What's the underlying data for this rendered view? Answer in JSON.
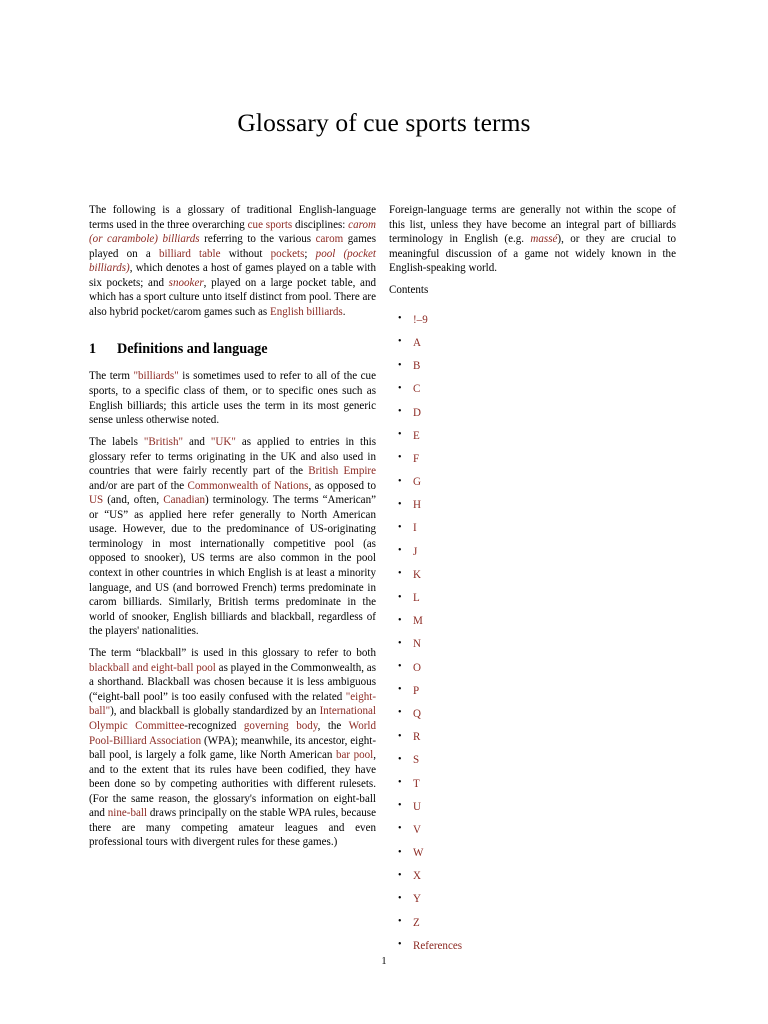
{
  "document": {
    "title": "Glossary of cue sports terms",
    "page_number": "1",
    "link_color": "#8c2a23",
    "text_color": "#000000",
    "background_color": "#ffffff"
  },
  "left_column": {
    "intro": {
      "runs": [
        {
          "text": "The following is a glossary of traditional English-language terms used in the three overarching ",
          "style": "plain"
        },
        {
          "text": "cue sports",
          "style": "link"
        },
        {
          "text": " disciplines: ",
          "style": "plain"
        },
        {
          "text": "carom (or carambole) billiards",
          "style": "link-italic"
        },
        {
          "text": " referring to the various ",
          "style": "plain"
        },
        {
          "text": "carom",
          "style": "link"
        },
        {
          "text": " games played on a ",
          "style": "plain"
        },
        {
          "text": "billiard table",
          "style": "link"
        },
        {
          "text": " without ",
          "style": "plain"
        },
        {
          "text": "pockets",
          "style": "link"
        },
        {
          "text": "; ",
          "style": "plain"
        },
        {
          "text": "pool (pocket billiards)",
          "style": "link-italic"
        },
        {
          "text": ", which denotes a host of games played on a table with six pockets; and ",
          "style": "plain"
        },
        {
          "text": "snooker",
          "style": "link-italic"
        },
        {
          "text": ", played on a large pocket table, and which has a sport culture unto itself distinct from pool. There are also hybrid pocket/carom games such as ",
          "style": "plain"
        },
        {
          "text": "English billiards",
          "style": "link"
        },
        {
          "text": ".",
          "style": "plain"
        }
      ]
    },
    "section": {
      "number": "1",
      "title": "Definitions and language"
    },
    "para_billiards": {
      "runs": [
        {
          "text": "The term ",
          "style": "plain"
        },
        {
          "text": "\"billiards\"",
          "style": "link"
        },
        {
          "text": " is sometimes used to refer to all of the cue sports, to a specific class of them, or to specific ones such as English billiards; this article uses the term in its most generic sense unless otherwise noted.",
          "style": "plain"
        }
      ]
    },
    "para_labels": {
      "runs": [
        {
          "text": "The labels ",
          "style": "plain"
        },
        {
          "text": "\"British\"",
          "style": "link"
        },
        {
          "text": " and ",
          "style": "plain"
        },
        {
          "text": "\"UK\"",
          "style": "link"
        },
        {
          "text": " as applied to entries in this glossary refer to terms originating in the UK and also used in countries that were fairly recently part of the ",
          "style": "plain"
        },
        {
          "text": "British Empire",
          "style": "link"
        },
        {
          "text": " and/or are part of the ",
          "style": "plain"
        },
        {
          "text": "Commonwealth of Nations",
          "style": "link"
        },
        {
          "text": ", as opposed to ",
          "style": "plain"
        },
        {
          "text": "US",
          "style": "link"
        },
        {
          "text": " (and, often, ",
          "style": "plain"
        },
        {
          "text": "Canadian",
          "style": "link"
        },
        {
          "text": ") terminology. The terms “American” or “US” as applied here refer generally to North American usage. However, due to the predominance of US-originating terminology in most internationally competitive pool (as opposed to snooker), US terms are also common in the pool context in other countries in which English is at least a minority language, and US (and borrowed French) terms predominate in carom billiards. Similarly, British terms predominate in the world of snooker, English billiards and blackball, regardless of the players' nationalities.",
          "style": "plain"
        }
      ]
    },
    "para_blackball": {
      "runs": [
        {
          "text": "The term “blackball” is used in this glossary to refer to both ",
          "style": "plain"
        },
        {
          "text": "blackball and eight-ball pool",
          "style": "link"
        },
        {
          "text": " as played in the Commonwealth, as a shorthand. Blackball was chosen because it is less ambiguous (“eight-ball pool” is too easily confused with the related ",
          "style": "plain"
        },
        {
          "text": "\"eight-ball\"",
          "style": "link"
        },
        {
          "text": "), and blackball is globally standardized by an ",
          "style": "plain"
        },
        {
          "text": "International Olympic Committee",
          "style": "link"
        },
        {
          "text": "-recognized ",
          "style": "plain"
        },
        {
          "text": "governing body",
          "style": "link"
        },
        {
          "text": ", the ",
          "style": "plain"
        },
        {
          "text": "World Pool-Billiard Association",
          "style": "link"
        },
        {
          "text": " (WPA); meanwhile, its ancestor, eight-ball pool, is largely a folk game, like North American ",
          "style": "plain"
        },
        {
          "text": "bar pool",
          "style": "link"
        },
        {
          "text": ", and to the extent that its rules have been codified, they have been done so by competing authorities with different rulesets. (For the same reason, the glossary's information on eight-ball and ",
          "style": "plain"
        },
        {
          "text": "nine-ball",
          "style": "link"
        },
        {
          "text": " draws principally on the stable WPA rules, because there are many competing amateur leagues and even professional tours with divergent rules for these games.)",
          "style": "plain"
        }
      ]
    }
  },
  "right_column": {
    "para_foreign": {
      "runs": [
        {
          "text": "Foreign-language terms are generally not within the scope of this list, unless they have become an integral part of billiards terminology in English (e.g. ",
          "style": "plain"
        },
        {
          "text": "massé",
          "style": "link-italic"
        },
        {
          "text": "), or they are crucial to meaningful discussion of a game not widely known in the English-speaking world.",
          "style": "plain"
        }
      ]
    },
    "contents_label": "Contents",
    "toc_items": [
      "!–9",
      "A",
      "B",
      "C",
      "D",
      "E",
      "F",
      "G",
      "H",
      "I",
      "J",
      "K",
      "L",
      "M",
      "N",
      "O",
      "P",
      "Q",
      "R",
      "S",
      "T",
      "U",
      "V",
      "W",
      "X",
      "Y",
      "Z",
      "References"
    ]
  }
}
